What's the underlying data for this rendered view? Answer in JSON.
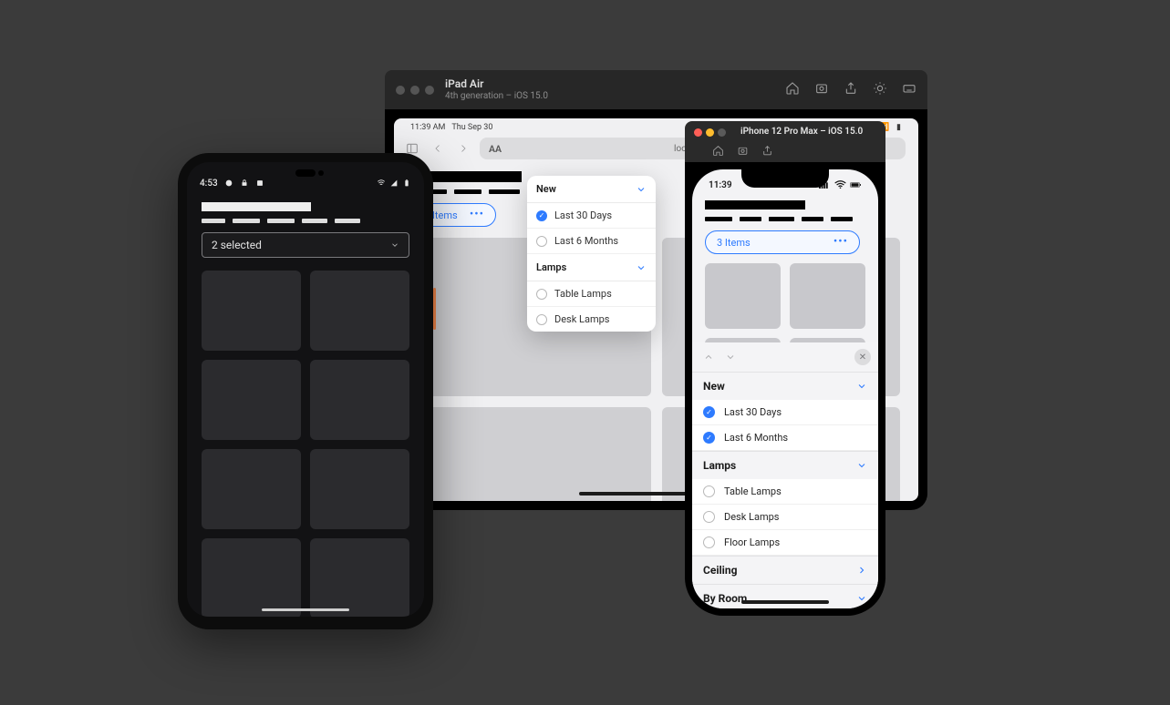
{
  "ipad": {
    "toolbar": {
      "title": "iPad Air",
      "subtitle": "4th generation – iOS 15.0"
    },
    "status": {
      "time": "11:39 AM",
      "date": "Thu Sep 30",
      "signal": "••••"
    },
    "safari": {
      "aa": "AA",
      "host": "localhost"
    },
    "pill": {
      "label": "2 Items",
      "more": "•••"
    },
    "popover": {
      "sections": [
        {
          "title": "New",
          "items": [
            {
              "label": "Last 30 Days",
              "checked": true
            },
            {
              "label": "Last 6 Months",
              "checked": false
            }
          ]
        },
        {
          "title": "Lamps",
          "items": [
            {
              "label": "Table Lamps",
              "checked": false
            },
            {
              "label": "Desk Lamps",
              "checked": false
            }
          ]
        }
      ]
    }
  },
  "iphone": {
    "toolbar": {
      "title": "iPhone 12 Pro Max – iOS 15.0"
    },
    "status": {
      "time": "11:39"
    },
    "pill": {
      "label": "3 Items",
      "more": "•••"
    },
    "sheet": {
      "sections": [
        {
          "title": "New",
          "expanded": true,
          "items": [
            {
              "label": "Last 30 Days",
              "checked": true
            },
            {
              "label": "Last 6 Months",
              "checked": true
            }
          ]
        },
        {
          "title": "Lamps",
          "expanded": true,
          "items": [
            {
              "label": "Table Lamps",
              "checked": false
            },
            {
              "label": "Desk Lamps",
              "checked": false
            },
            {
              "label": "Floor Lamps",
              "checked": false
            }
          ]
        },
        {
          "title": "Ceiling",
          "expanded": false
        },
        {
          "title": "By Room",
          "expanded": false
        }
      ]
    }
  },
  "android": {
    "status": {
      "time": "4:53"
    },
    "select": {
      "label": "2 selected"
    }
  }
}
